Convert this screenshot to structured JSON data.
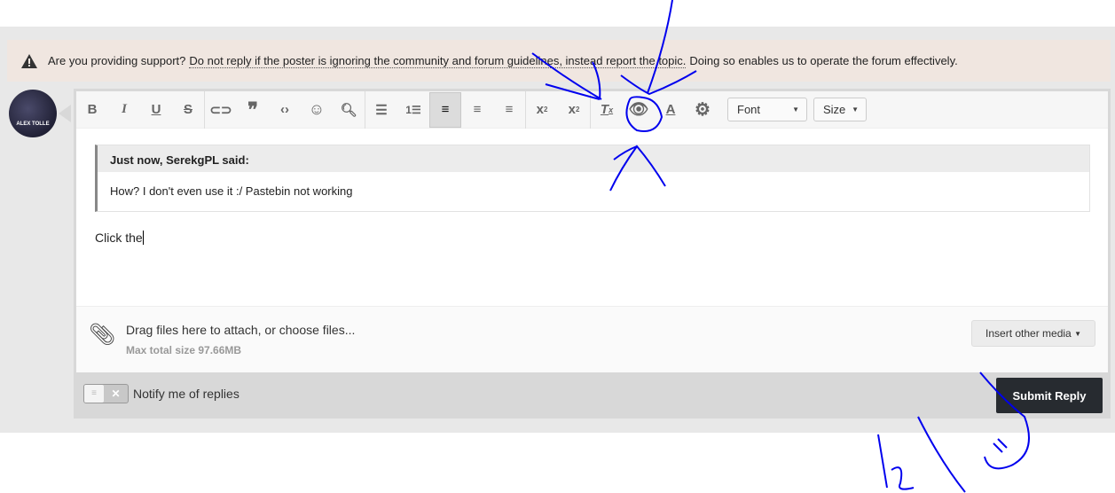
{
  "notice": {
    "prefix": "Are you providing support?",
    "link": "Do not reply if the poster is ignoring the community and forum guidelines, instead report the topic.",
    "suffix": "Doing so enables us to operate the forum effectively."
  },
  "avatar": {
    "text": "ALEX TOLLE"
  },
  "toolbar": {
    "buttons": [
      "bold",
      "italic",
      "underline",
      "strikethrough",
      "link",
      "quote",
      "code",
      "emoji",
      "search",
      "bullet-list",
      "numbered-list",
      "align-left",
      "align-center",
      "align-right",
      "superscript",
      "subscript",
      "remove-format",
      "preview",
      "text-color",
      "settings"
    ],
    "font_label": "Font",
    "size_label": "Size",
    "active": "align-left"
  },
  "quote": {
    "header": "Just now, SerekgPL said:",
    "body": "How? I don't even use it :/ Pastebin not working"
  },
  "editor": {
    "text": "Click the"
  },
  "attach": {
    "prompt": "Drag files here to attach, or ",
    "choose": "choose files...",
    "max": "Max total size 97.66MB",
    "media_label": "Insert other media"
  },
  "footer": {
    "notify_label": "Notify me of replies",
    "notify_on": false,
    "submit_label": "Submit Reply"
  },
  "colors": {
    "annotation": "#0000ee",
    "submit": "#272b30",
    "notice_bg": "#f0e6e0"
  }
}
